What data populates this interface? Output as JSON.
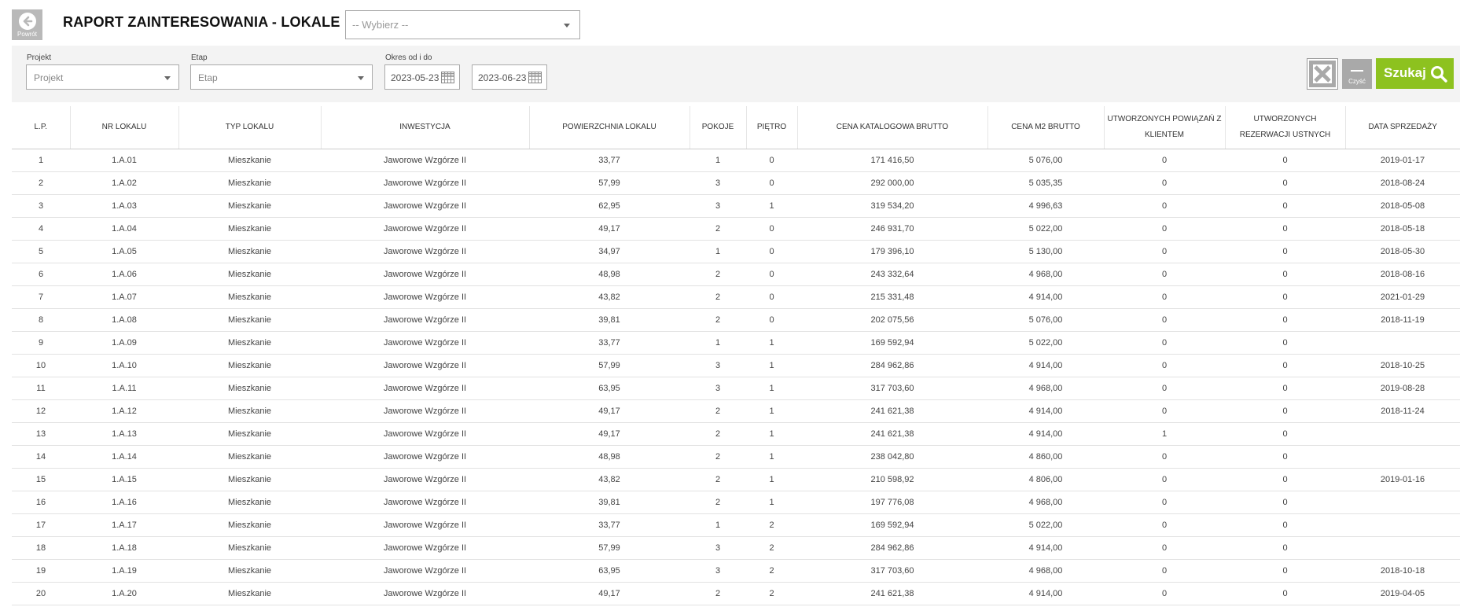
{
  "header": {
    "back_label": "Powrót",
    "title": "RAPORT ZAINTERESOWANIA - LOKALE",
    "select_placeholder": "-- Wybierz --"
  },
  "filters": {
    "project_label": "Projekt",
    "project_placeholder": "Projekt",
    "stage_label": "Etap",
    "stage_placeholder": "Etap",
    "period_label": "Okres od i do",
    "date_from": "2023-05-23",
    "date_to": "2023-06-23",
    "clear_label": "Czyść",
    "search_label": "Szukaj",
    "search_color": "#8dc21f"
  },
  "table": {
    "columns": [
      "L.P.",
      "NR LOKALU",
      "TYP LOKALU",
      "INWESTYCJA",
      "POWIERZCHNIA LOKALU",
      "POKOJE",
      "PIĘTRO",
      "CENA KATALOGOWA BRUTTO",
      "CENA M2 BRUTTO",
      "UTWORZONYCH POWIĄZAŃ Z KLIENTEM",
      "UTWORZONYCH REZERWACJI USTNYCH",
      "DATA SPRZEDAŻY"
    ],
    "rows": [
      [
        "1",
        "1.A.01",
        "Mieszkanie",
        "Jaworowe Wzgórze II",
        "33,77",
        "1",
        "0",
        "171 416,50",
        "5 076,00",
        "0",
        "0",
        "2019-01-17"
      ],
      [
        "2",
        "1.A.02",
        "Mieszkanie",
        "Jaworowe Wzgórze II",
        "57,99",
        "3",
        "0",
        "292 000,00",
        "5 035,35",
        "0",
        "0",
        "2018-08-24"
      ],
      [
        "3",
        "1.A.03",
        "Mieszkanie",
        "Jaworowe Wzgórze II",
        "62,95",
        "3",
        "1",
        "319 534,20",
        "4 996,63",
        "0",
        "0",
        "2018-05-08"
      ],
      [
        "4",
        "1.A.04",
        "Mieszkanie",
        "Jaworowe Wzgórze II",
        "49,17",
        "2",
        "0",
        "246 931,70",
        "5 022,00",
        "0",
        "0",
        "2018-05-18"
      ],
      [
        "5",
        "1.A.05",
        "Mieszkanie",
        "Jaworowe Wzgórze II",
        "34,97",
        "1",
        "0",
        "179 396,10",
        "5 130,00",
        "0",
        "0",
        "2018-05-30"
      ],
      [
        "6",
        "1.A.06",
        "Mieszkanie",
        "Jaworowe Wzgórze II",
        "48,98",
        "2",
        "0",
        "243 332,64",
        "4 968,00",
        "0",
        "0",
        "2018-08-16"
      ],
      [
        "7",
        "1.A.07",
        "Mieszkanie",
        "Jaworowe Wzgórze II",
        "43,82",
        "2",
        "0",
        "215 331,48",
        "4 914,00",
        "0",
        "0",
        "2021-01-29"
      ],
      [
        "8",
        "1.A.08",
        "Mieszkanie",
        "Jaworowe Wzgórze II",
        "39,81",
        "2",
        "0",
        "202 075,56",
        "5 076,00",
        "0",
        "0",
        "2018-11-19"
      ],
      [
        "9",
        "1.A.09",
        "Mieszkanie",
        "Jaworowe Wzgórze II",
        "33,77",
        "1",
        "1",
        "169 592,94",
        "5 022,00",
        "0",
        "0",
        ""
      ],
      [
        "10",
        "1.A.10",
        "Mieszkanie",
        "Jaworowe Wzgórze II",
        "57,99",
        "3",
        "1",
        "284 962,86",
        "4 914,00",
        "0",
        "0",
        "2018-10-25"
      ],
      [
        "11",
        "1.A.11",
        "Mieszkanie",
        "Jaworowe Wzgórze II",
        "63,95",
        "3",
        "1",
        "317 703,60",
        "4 968,00",
        "0",
        "0",
        "2019-08-28"
      ],
      [
        "12",
        "1.A.12",
        "Mieszkanie",
        "Jaworowe Wzgórze II",
        "49,17",
        "2",
        "1",
        "241 621,38",
        "4 914,00",
        "0",
        "0",
        "2018-11-24"
      ],
      [
        "13",
        "1.A.13",
        "Mieszkanie",
        "Jaworowe Wzgórze II",
        "49,17",
        "2",
        "1",
        "241 621,38",
        "4 914,00",
        "1",
        "0",
        ""
      ],
      [
        "14",
        "1.A.14",
        "Mieszkanie",
        "Jaworowe Wzgórze II",
        "48,98",
        "2",
        "1",
        "238 042,80",
        "4 860,00",
        "0",
        "0",
        ""
      ],
      [
        "15",
        "1.A.15",
        "Mieszkanie",
        "Jaworowe Wzgórze II",
        "43,82",
        "2",
        "1",
        "210 598,92",
        "4 806,00",
        "0",
        "0",
        "2019-01-16"
      ],
      [
        "16",
        "1.A.16",
        "Mieszkanie",
        "Jaworowe Wzgórze II",
        "39,81",
        "2",
        "1",
        "197 776,08",
        "4 968,00",
        "0",
        "0",
        ""
      ],
      [
        "17",
        "1.A.17",
        "Mieszkanie",
        "Jaworowe Wzgórze II",
        "33,77",
        "1",
        "2",
        "169 592,94",
        "5 022,00",
        "0",
        "0",
        ""
      ],
      [
        "18",
        "1.A.18",
        "Mieszkanie",
        "Jaworowe Wzgórze II",
        "57,99",
        "3",
        "2",
        "284 962,86",
        "4 914,00",
        "0",
        "0",
        ""
      ],
      [
        "19",
        "1.A.19",
        "Mieszkanie",
        "Jaworowe Wzgórze II",
        "63,95",
        "3",
        "2",
        "317 703,60",
        "4 968,00",
        "0",
        "0",
        "2018-10-18"
      ],
      [
        "20",
        "1.A.20",
        "Mieszkanie",
        "Jaworowe Wzgórze II",
        "49,17",
        "2",
        "2",
        "241 621,38",
        "4 914,00",
        "0",
        "0",
        "2019-04-05"
      ]
    ]
  }
}
